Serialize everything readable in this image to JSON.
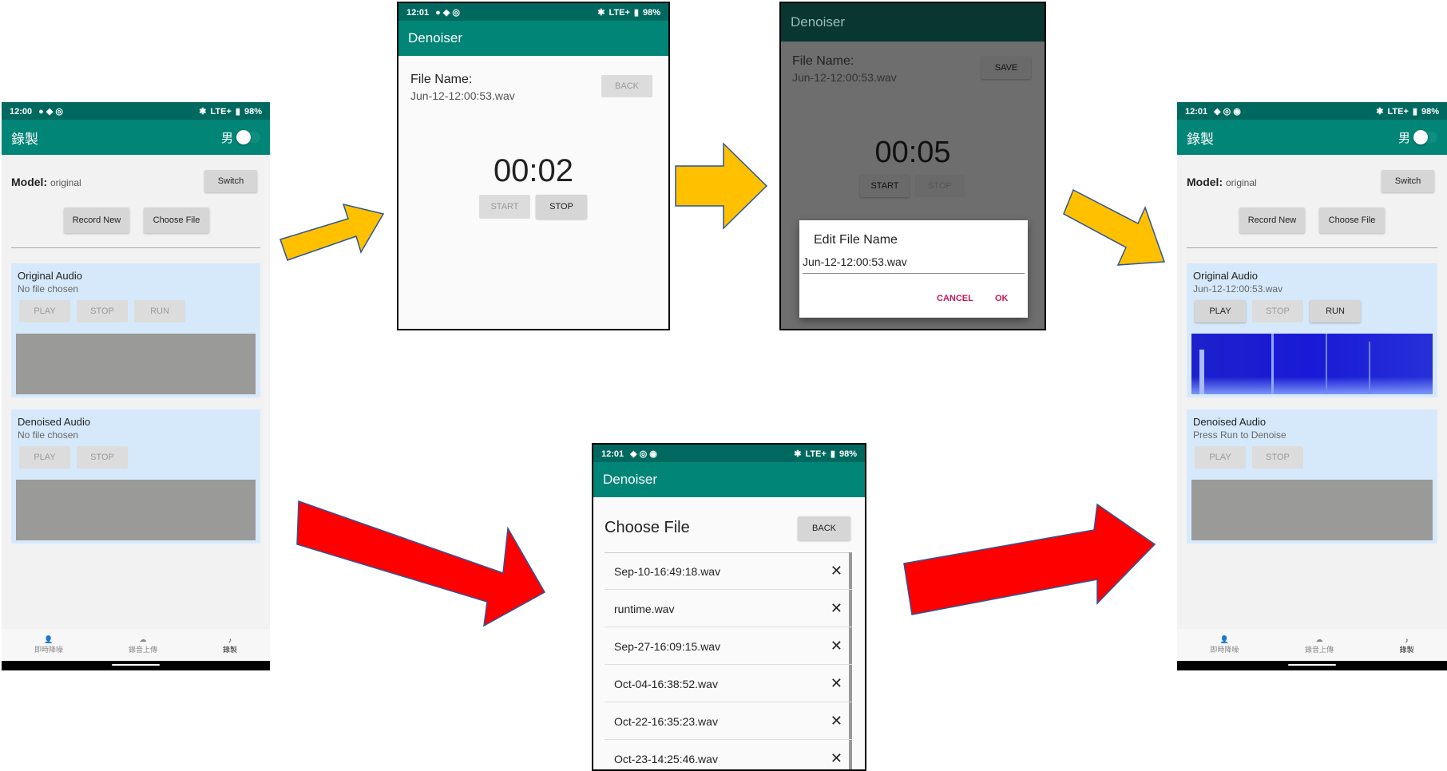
{
  "panel1": {
    "status": {
      "time": "12:00",
      "right": "LTE+",
      "battery": "98%"
    },
    "title": "錄製",
    "toggle": "男",
    "model_label": "Model:",
    "model_value": "original",
    "switch": "Switch",
    "record_new": "Record New",
    "choose_file": "Choose File",
    "orig_title": "Original Audio",
    "orig_sub": "No file chosen",
    "play": "PLAY",
    "stop": "STOP",
    "run": "RUN",
    "den_title": "Denoised Audio",
    "den_sub": "No file chosen",
    "nav": [
      "即時降噪",
      "錄音上傳",
      "錄製"
    ]
  },
  "panel2": {
    "status": {
      "time": "12:01",
      "right": "LTE+",
      "battery": "98%"
    },
    "title": "Denoiser",
    "file_label": "File Name:",
    "file_value": "Jun-12-12:00:53.wav",
    "back": "BACK",
    "timer": "00:02",
    "start": "START",
    "stop": "STOP"
  },
  "panel3": {
    "title": "Denoiser",
    "file_label": "File Name:",
    "file_value": "Jun-12-12:00:53.wav",
    "save": "SAVE",
    "timer": "00:05",
    "start": "START",
    "stop": "STOP",
    "dialog_title": "Edit File Name",
    "dialog_value": "Jun-12-12:00:53.wav",
    "cancel": "CANCEL",
    "ok": "OK"
  },
  "panel4": {
    "status": {
      "time": "12:01",
      "right": "LTE+",
      "battery": "98%"
    },
    "title": "Denoiser",
    "heading": "Choose File",
    "back": "BACK",
    "files": [
      "Sep-10-16:49:18.wav",
      "runtime.wav",
      "Sep-27-16:09:15.wav",
      "Oct-04-16:38:52.wav",
      "Oct-22-16:35:23.wav",
      "Oct-23-14:25:46.wav"
    ],
    "delete_glyph": "✕"
  },
  "panel5": {
    "status": {
      "time": "12:01",
      "right": "LTE+",
      "battery": "98%"
    },
    "title": "錄製",
    "toggle": "男",
    "model_label": "Model:",
    "model_value": "original",
    "switch": "Switch",
    "record_new": "Record New",
    "choose_file": "Choose File",
    "orig_title": "Original Audio",
    "orig_sub": "Jun-12-12:00:53.wav",
    "play": "PLAY",
    "stop": "STOP",
    "run": "RUN",
    "den_title": "Denoised Audio",
    "den_sub": "Press Run to Denoise",
    "nav": [
      "即時降噪",
      "錄音上傳",
      "錄製"
    ]
  },
  "colors": {
    "status_bar": "#00695f",
    "app_bar": "#008577",
    "card": "#d6e9fb",
    "yellow_arrow": "#ffc000",
    "red_arrow": "#ff0000",
    "accent": "#c2185b",
    "spectrogram": "#1a1ad6"
  }
}
